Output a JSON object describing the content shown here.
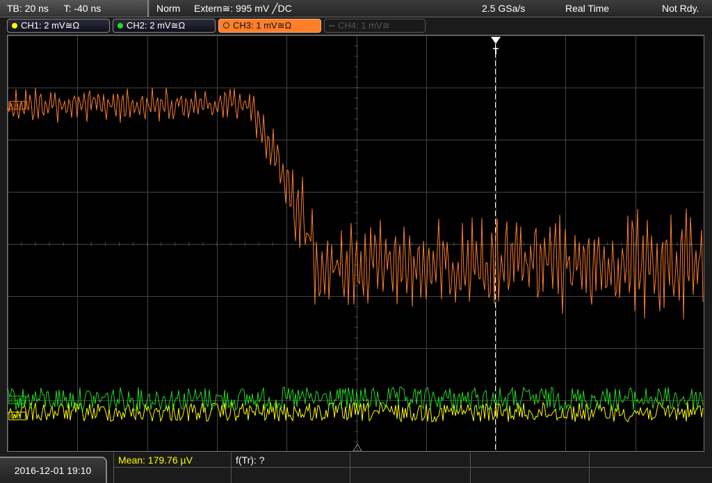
{
  "topbar": {
    "timebase": "TB: 20 ns",
    "trigger_pos": "T: -40 ns",
    "trigger_mode": "Norm",
    "trigger_source": "Extern≅: 995 mV ╱DC",
    "sample_rate": "2.5 GSa/s",
    "acq_mode": "Real Time",
    "status": "Not Rdy."
  },
  "channels": [
    {
      "label": "CH1: 2 mV≅Ω",
      "color": "#ffff00",
      "state": "on"
    },
    {
      "label": "CH2: 2 mV≅Ω",
      "color": "#22dd22",
      "state": "on"
    },
    {
      "label": "CH3: 1 mV≅Ω",
      "color": "#ff7f2a",
      "state": "active"
    },
    {
      "label": "CH4: 1 mV≅",
      "color": "#555555",
      "state": "off"
    }
  ],
  "screen": {
    "trigger_marker": "T",
    "ch3_marker": "CH3",
    "ch2_marker": "CH2",
    "ch1_marker": "CH1",
    "colors": {
      "ch1": "#ffff00",
      "ch2": "#22dd22",
      "ch3": "#ff7f2a",
      "grid": "#444444",
      "trigger_line": "#ffffff"
    }
  },
  "bottom": {
    "datetime": "2016-12-01 19:10",
    "mean_label": "Mean: 179.76 µV",
    "freq_label": "f(Tr): ?"
  }
}
